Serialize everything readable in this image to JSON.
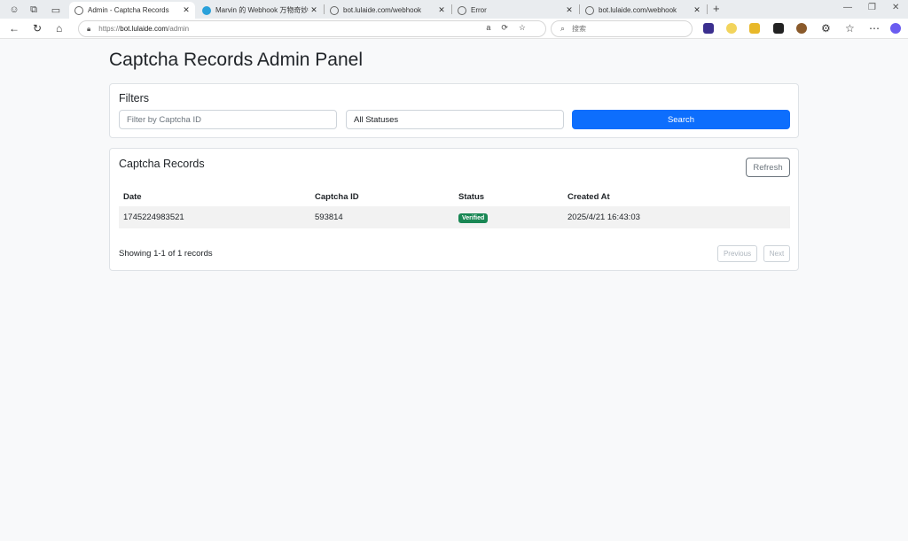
{
  "browser": {
    "tabs": [
      {
        "title": "Admin - Captcha Records"
      },
      {
        "title": "Marvin 的 Webhook 万物奇妙指南"
      },
      {
        "title": "bot.lulaide.com/webhook"
      },
      {
        "title": "Error"
      },
      {
        "title": "bot.lulaide.com/webhook"
      }
    ],
    "address": {
      "protocol": "https://",
      "host": "bot.lulaide.com",
      "path": "/admin"
    },
    "search_placeholder": "搜索"
  },
  "page": {
    "title": "Captcha Records Admin Panel",
    "filters": {
      "heading": "Filters",
      "captcha_placeholder": "Filter by Captcha ID",
      "status_value": "All Statuses",
      "search_label": "Search"
    },
    "records": {
      "heading": "Captcha Records",
      "refresh_label": "Refresh",
      "columns": [
        "Date",
        "Captcha ID",
        "Status",
        "Created At"
      ],
      "rows": [
        {
          "date": "1745224983521",
          "captcha_id": "593814",
          "status": "Verified",
          "created_at": "2025/4/21 16:43:03"
        }
      ],
      "summary": "Showing 1-1 of 1 records",
      "prev_label": "Previous",
      "next_label": "Next"
    }
  },
  "colors": {
    "primary": "#0d6efd",
    "success": "#198754"
  }
}
